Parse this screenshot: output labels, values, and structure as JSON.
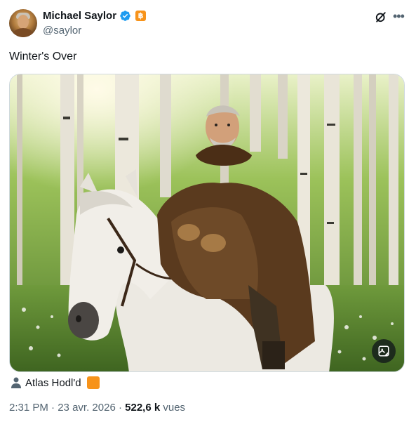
{
  "author": {
    "name": "Michael Saylor",
    "handle": "@saylor",
    "badge_glyph": "฿"
  },
  "tweet": {
    "text": "Winter's Over"
  },
  "credit": {
    "label": "Atlas Hodl'd"
  },
  "meta": {
    "time": "2:31 PM",
    "separator": "·",
    "date": "23 avr. 2026",
    "views_count": "522,6 k",
    "views_label": "vues"
  },
  "icons": {
    "verified": "verified-badge-icon",
    "grok": "grok-icon",
    "more": "more-options-icon",
    "media_action": "image-edit-icon",
    "credit": "person-icon"
  },
  "colors": {
    "verified": "#1d9bf0",
    "bitcoin": "#f7931a",
    "secondary_text": "#536471"
  }
}
